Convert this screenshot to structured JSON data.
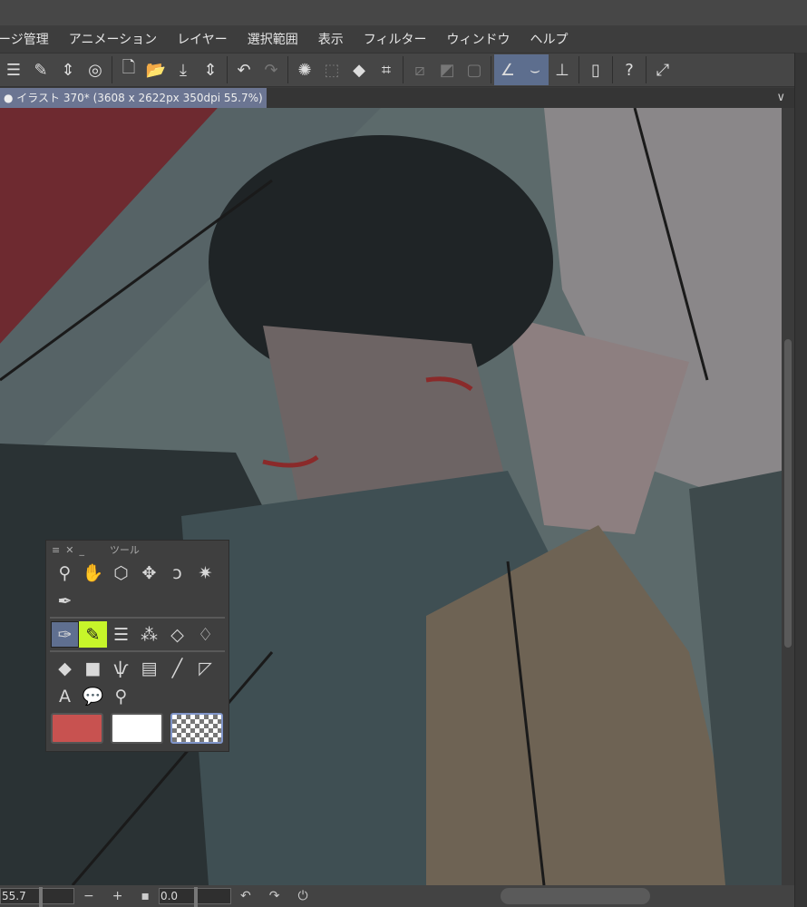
{
  "menu": [
    "ージ管理",
    "アニメーション",
    "レイヤー",
    "選択範囲",
    "表示",
    "フィルター",
    "ウィンドウ",
    "ヘルプ"
  ],
  "tab": {
    "title": "● イラスト 370* (3608 x 2622px 350dpi 55.7%)",
    "menu_icon": "chevron-down-icon"
  },
  "toolpanel": {
    "title": "ツール"
  },
  "colors": {
    "main": "#c85250",
    "sub": "#ffffff",
    "accent": "#5f6f90",
    "highlight": "#c7f52a"
  },
  "status": {
    "zoom": "55.7",
    "rotation": "0.0"
  }
}
